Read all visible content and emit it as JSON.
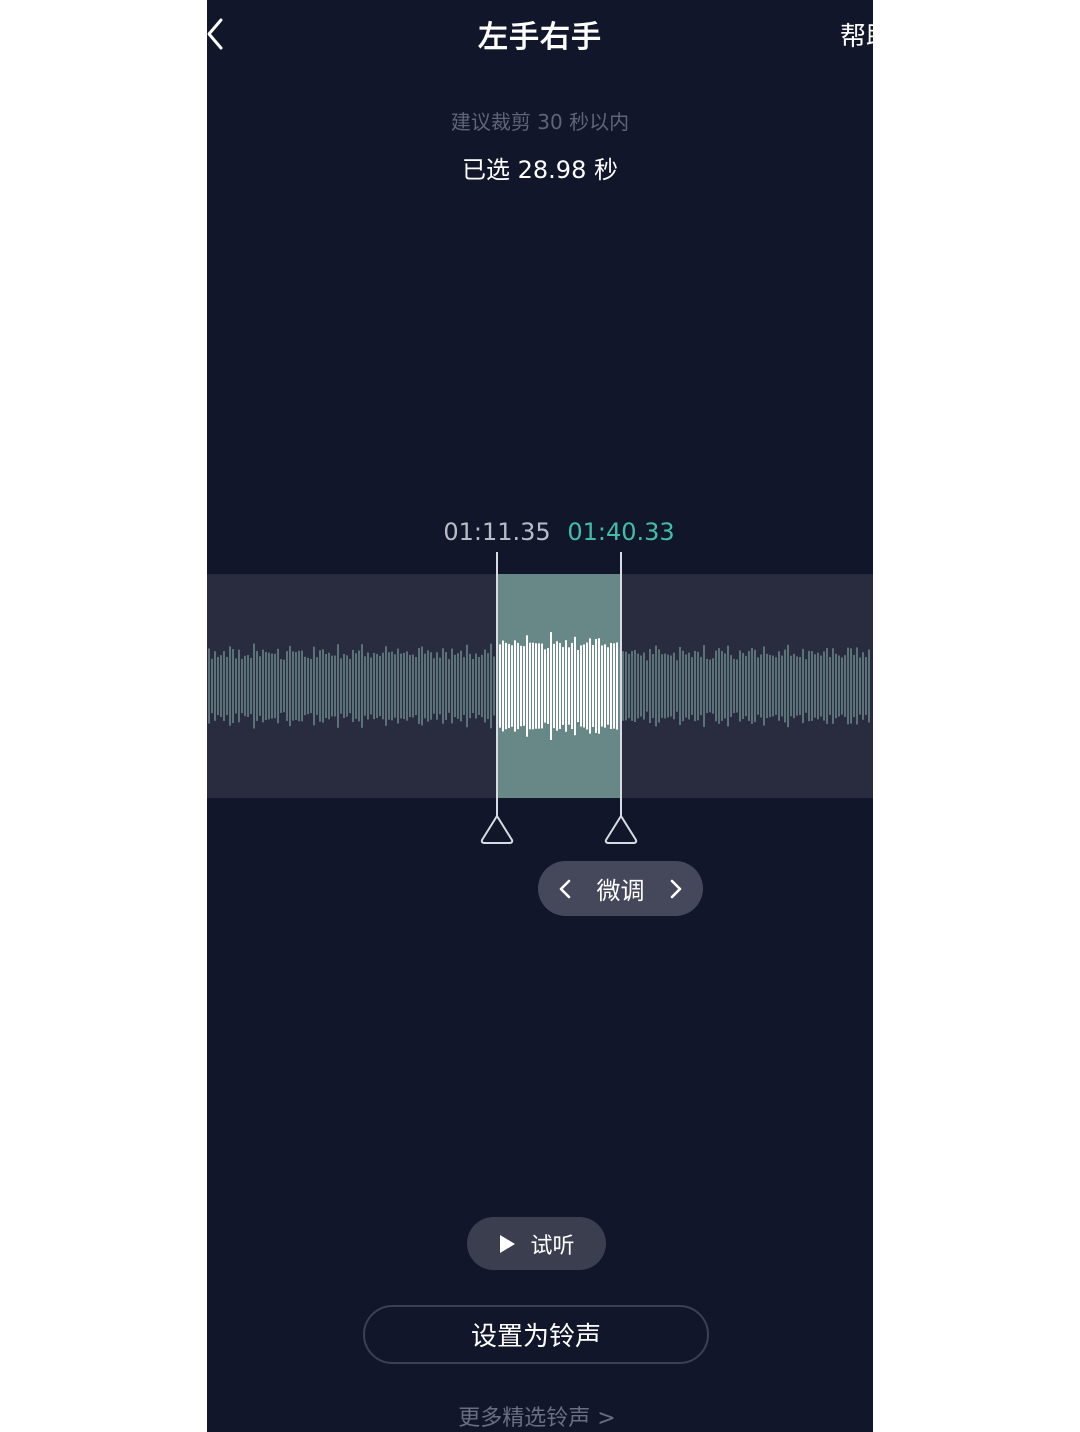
{
  "header": {
    "title": "左手右手",
    "help_label": "帮助"
  },
  "info": {
    "hint": "建议裁剪 30 秒以内",
    "selected": "已选 28.98 秒"
  },
  "trim": {
    "start_time": "01:11.35",
    "end_time": "01:40.33",
    "fine_tune_label": "微调"
  },
  "actions": {
    "preview_label": "试听",
    "set_ringtone_label": "设置为铃声",
    "more_label": "更多精选铃声 >"
  },
  "colors": {
    "background": "#12162a",
    "track": "#282c3e",
    "selection": "#688787",
    "end_time_accent": "#3fc0a5"
  }
}
